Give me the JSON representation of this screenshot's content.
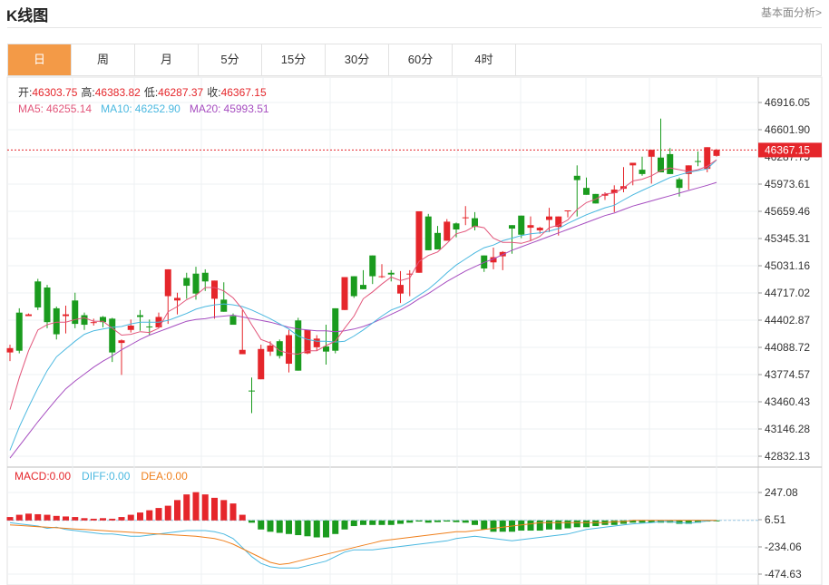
{
  "header": {
    "title": "K线图",
    "fundamental_link": "基本面分析>"
  },
  "tabs": [
    {
      "label": "日",
      "active": true
    },
    {
      "label": "周",
      "active": false
    },
    {
      "label": "月",
      "active": false
    },
    {
      "label": "5分",
      "active": false
    },
    {
      "label": "15分",
      "active": false
    },
    {
      "label": "30分",
      "active": false
    },
    {
      "label": "60分",
      "active": false
    },
    {
      "label": "4时",
      "active": false
    }
  ],
  "info": {
    "open_label": "开:",
    "open": "46303.75",
    "high_label": "高:",
    "high": "46383.82",
    "low_label": "低:",
    "low": "46287.37",
    "close_label": "收:",
    "close": "46367.15",
    "ma5_label": "MA5:",
    "ma5": "46255.14",
    "ma10_label": "MA10:",
    "ma10": "46252.90",
    "ma20_label": "MA20:",
    "ma20": "45993.51"
  },
  "macd_info": {
    "macd_label": "MACD:",
    "macd": "0.00",
    "diff_label": "DIFF:",
    "diff": "0.00",
    "dea_label": "DEA:",
    "dea": "0.00"
  },
  "colors": {
    "up": "#e5262b",
    "down": "#1a9b1e",
    "ma5": "#e2557a",
    "ma10": "#4ab8e0",
    "ma20": "#a64dc0",
    "dea": "#ef7f1b",
    "accent": "#f39a47"
  },
  "chart_data": [
    {
      "type": "candlestick",
      "price_axis_ticks": [
        "46916.05",
        "46601.90",
        "46287.75",
        "45973.61",
        "45659.46",
        "45345.31",
        "45031.16",
        "44717.02",
        "44402.87",
        "44088.72",
        "43774.57",
        "43460.43",
        "43146.28",
        "42832.13"
      ],
      "ylim": [
        42832.13,
        46916.05
      ],
      "last_price": "46367.15",
      "candles": [
        [
          44030,
          44120,
          43930,
          44080
        ],
        [
          44490,
          44540,
          44020,
          44050
        ],
        [
          44450,
          44480,
          44450,
          44470
        ],
        [
          44850,
          44880,
          44520,
          44550
        ],
        [
          44780,
          44810,
          44310,
          44380
        ],
        [
          44540,
          44560,
          44180,
          44240
        ],
        [
          44450,
          44570,
          44250,
          44470
        ],
        [
          44630,
          44720,
          44310,
          44360
        ],
        [
          44460,
          44490,
          44290,
          44350
        ],
        [
          44380,
          44420,
          44340,
          44380
        ],
        [
          44440,
          44450,
          44320,
          44380
        ],
        [
          44420,
          44430,
          43920,
          44030
        ],
        [
          44140,
          44180,
          43770,
          44170
        ],
        [
          44290,
          44410,
          44260,
          44340
        ],
        [
          44460,
          44520,
          44280,
          44440
        ],
        [
          44330,
          44410,
          44230,
          44320
        ],
        [
          44320,
          44490,
          44310,
          44440
        ],
        [
          44680,
          44710,
          44360,
          44990
        ],
        [
          44630,
          44720,
          44470,
          44660
        ],
        [
          44890,
          44950,
          44650,
          44800
        ],
        [
          44940,
          45020,
          44640,
          44710
        ],
        [
          44950,
          44990,
          44740,
          44850
        ],
        [
          44650,
          44700,
          44420,
          44860
        ],
        [
          44640,
          44840,
          44500,
          44500
        ],
        [
          44450,
          44480,
          44390,
          44350
        ],
        [
          44010,
          44520,
          44210,
          44060
        ],
        [
          43590,
          43740,
          43330,
          43580
        ],
        [
          43720,
          44120,
          43720,
          44070
        ],
        [
          44040,
          44160,
          43990,
          44110
        ],
        [
          44160,
          44180,
          43960,
          43990
        ],
        [
          43900,
          44290,
          43800,
          44230
        ],
        [
          44400,
          44430,
          43860,
          43820
        ],
        [
          44020,
          44240,
          44010,
          44290
        ],
        [
          44090,
          44230,
          44050,
          44190
        ],
        [
          44100,
          44350,
          43890,
          44040
        ],
        [
          44540,
          44540,
          44020,
          44050
        ],
        [
          44520,
          44670,
          44550,
          44900
        ],
        [
          44910,
          44660,
          44900,
          44680
        ],
        [
          44810,
          44980,
          44970,
          44760
        ],
        [
          45150,
          44900,
          44820,
          44910
        ],
        [
          44910,
          45050,
          44890,
          44910
        ],
        [
          44950,
          44980,
          44850,
          44930
        ],
        [
          44710,
          44970,
          44600,
          44810
        ],
        [
          44930,
          44980,
          44680,
          44940
        ],
        [
          44950,
          45660,
          44950,
          45660
        ],
        [
          45600,
          45630,
          45410,
          45210
        ],
        [
          45410,
          45490,
          45230,
          45220
        ],
        [
          45320,
          45410,
          45570,
          45540
        ],
        [
          45520,
          45530,
          45360,
          45450
        ],
        [
          45590,
          45720,
          45500,
          45590
        ],
        [
          45580,
          45650,
          45440,
          45480
        ],
        [
          45150,
          45130,
          44960,
          45000
        ],
        [
          45070,
          45240,
          44990,
          45130
        ],
        [
          45140,
          45200,
          44980,
          45190
        ],
        [
          45500,
          45450,
          45170,
          45460
        ],
        [
          45610,
          45610,
          45350,
          45390
        ],
        [
          45470,
          45600,
          45320,
          45500
        ],
        [
          45440,
          45480,
          45400,
          45470
        ],
        [
          45560,
          45700,
          45420,
          45600
        ],
        [
          45480,
          45500,
          45380,
          45600
        ],
        [
          45660,
          45670,
          45590,
          45670
        ],
        [
          46070,
          46190,
          45600,
          46020
        ],
        [
          45930,
          46050,
          45990,
          45850
        ],
        [
          45860,
          45790,
          45850,
          45750
        ],
        [
          45840,
          45880,
          45790,
          45860
        ],
        [
          45870,
          45960,
          45650,
          45910
        ],
        [
          45920,
          46170,
          45880,
          45950
        ],
        [
          46190,
          46220,
          45960,
          46220
        ],
        [
          46140,
          46290,
          46070,
          46090
        ],
        [
          46290,
          46340,
          45980,
          46370
        ],
        [
          46280,
          46730,
          46380,
          46110
        ],
        [
          46320,
          46390,
          46100,
          46090
        ],
        [
          46030,
          46050,
          45830,
          45930
        ],
        [
          46090,
          46130,
          45910,
          46190
        ],
        [
          46240,
          46350,
          46180,
          46230
        ],
        [
          46150,
          46370,
          46110,
          46400
        ],
        [
          46300,
          46380,
          46290,
          46370
        ]
      ],
      "ma5": [
        43370,
        43740,
        44050,
        44290,
        44350,
        44380,
        44380,
        44410,
        44430,
        44390,
        44390,
        44310,
        44230,
        44240,
        44270,
        44260,
        44310,
        44500,
        44560,
        44640,
        44690,
        44780,
        44780,
        44740,
        44660,
        44530,
        44350,
        44180,
        44140,
        44050,
        44020,
        44010,
        44050,
        44050,
        44110,
        44160,
        44310,
        44450,
        44650,
        44730,
        44820,
        44900,
        44860,
        44890,
        45080,
        45150,
        45190,
        45290,
        45400,
        45430,
        45490,
        45470,
        45350,
        45300,
        45300,
        45290,
        45320,
        45370,
        45470,
        45500,
        45560,
        45680,
        45760,
        45800,
        45860,
        45870,
        45930,
        46010,
        46030,
        46070,
        46130,
        46160,
        46140,
        46120,
        46140,
        46180,
        46255
      ],
      "ma10": [
        42900,
        43170,
        43400,
        43620,
        43820,
        43980,
        44070,
        44160,
        44240,
        44280,
        44300,
        44320,
        44330,
        44360,
        44380,
        44380,
        44380,
        44400,
        44440,
        44480,
        44530,
        44560,
        44580,
        44590,
        44580,
        44560,
        44520,
        44470,
        44420,
        44360,
        44300,
        44220,
        44180,
        44160,
        44160,
        44150,
        44160,
        44220,
        44290,
        44370,
        44450,
        44520,
        44560,
        44620,
        44690,
        44760,
        44850,
        44950,
        45040,
        45110,
        45180,
        45240,
        45270,
        45320,
        45350,
        45380,
        45400,
        45410,
        45430,
        45460,
        45520,
        45570,
        45620,
        45660,
        45700,
        45730,
        45790,
        45850,
        45900,
        45950,
        46000,
        46050,
        46080,
        46110,
        46130,
        46150,
        46252
      ],
      "ma20": [
        42810,
        42950,
        43090,
        43230,
        43360,
        43490,
        43610,
        43700,
        43780,
        43860,
        43930,
        43990,
        44060,
        44120,
        44180,
        44230,
        44270,
        44310,
        44350,
        44390,
        44410,
        44420,
        44440,
        44450,
        44460,
        44440,
        44420,
        44400,
        44380,
        44350,
        44320,
        44300,
        44290,
        44280,
        44280,
        44270,
        44280,
        44300,
        44330,
        44370,
        44420,
        44470,
        44520,
        44580,
        44650,
        44710,
        44780,
        44850,
        44910,
        44970,
        45020,
        45070,
        45110,
        45160,
        45210,
        45250,
        45290,
        45330,
        45370,
        45410,
        45450,
        45490,
        45530,
        45570,
        45610,
        45640,
        45680,
        45720,
        45750,
        45780,
        45810,
        45840,
        45870,
        45900,
        45930,
        45960,
        45993
      ]
    },
    {
      "type": "bar",
      "name": "MACD",
      "axis_ticks": [
        "247.08",
        "6.51",
        "-234.06",
        "-474.63"
      ],
      "ylim": [
        -474.63,
        247.08
      ],
      "hist": [
        30,
        50,
        60,
        55,
        50,
        40,
        35,
        30,
        20,
        15,
        20,
        15,
        30,
        50,
        70,
        90,
        110,
        130,
        180,
        230,
        250,
        230,
        200,
        180,
        150,
        50,
        -20,
        -80,
        -100,
        -110,
        -120,
        -130,
        -140,
        -150,
        -150,
        -120,
        -80,
        -50,
        -40,
        -40,
        -40,
        -40,
        -30,
        -20,
        -10,
        -20,
        -15,
        -10,
        -15,
        -20,
        -40,
        -80,
        -100,
        -100,
        -100,
        -90,
        -90,
        -90,
        -80,
        -80,
        -70,
        -60,
        -60,
        -50,
        -40,
        -40,
        -30,
        -20,
        -20,
        -20,
        -20,
        -20,
        -30,
        -30,
        -20,
        -10,
        -5
      ],
      "diff": [
        -20,
        -30,
        -40,
        -50,
        -70,
        -60,
        -80,
        -90,
        -100,
        -110,
        -120,
        -120,
        -130,
        -140,
        -140,
        -130,
        -120,
        -110,
        -100,
        -90,
        -90,
        -90,
        -100,
        -120,
        -160,
        -240,
        -320,
        -380,
        -410,
        -420,
        -420,
        -420,
        -400,
        -380,
        -360,
        -320,
        -280,
        -260,
        -260,
        -260,
        -250,
        -240,
        -230,
        -220,
        -210,
        -200,
        -190,
        -180,
        -160,
        -150,
        -140,
        -150,
        -160,
        -170,
        -180,
        -170,
        -160,
        -150,
        -140,
        -130,
        -120,
        -100,
        -80,
        -70,
        -60,
        -50,
        -40,
        -30,
        -25,
        -20,
        -10,
        -10,
        -20,
        -25,
        -15,
        -5,
        0
      ],
      "dea": [
        -40,
        -45,
        -50,
        -55,
        -60,
        -65,
        -70,
        -75,
        -80,
        -85,
        -90,
        -95,
        -100,
        -105,
        -110,
        -115,
        -120,
        -125,
        -130,
        -135,
        -140,
        -150,
        -160,
        -180,
        -210,
        -250,
        -290,
        -330,
        -370,
        -390,
        -380,
        -360,
        -340,
        -320,
        -300,
        -280,
        -260,
        -240,
        -220,
        -200,
        -180,
        -170,
        -160,
        -150,
        -140,
        -130,
        -120,
        -110,
        -100,
        -100,
        -90,
        -80,
        -70,
        -60,
        -50,
        -40,
        -30,
        -20,
        -20,
        -20,
        -20,
        -20,
        -20,
        -20,
        -20,
        -10,
        -10,
        0,
        0,
        0,
        0,
        0,
        0,
        0,
        0,
        0,
        0
      ]
    }
  ]
}
